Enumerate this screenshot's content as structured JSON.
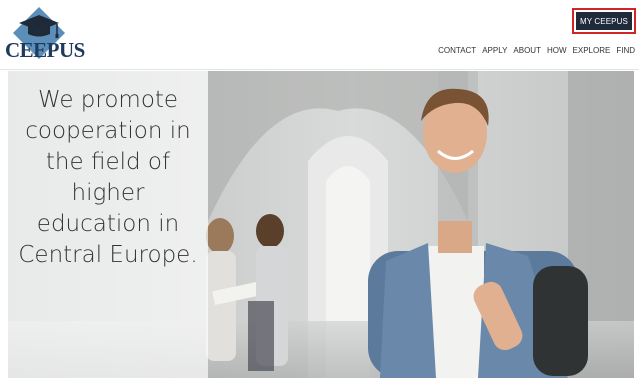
{
  "header": {
    "logo_text": "CEEPUS",
    "my_ceepus_label": "MY CEEPUS",
    "nav": [
      "CONTACT",
      "APPLY",
      "ABOUT",
      "HOW",
      "EXPLORE",
      "FIND"
    ]
  },
  "hero": {
    "tagline": "We promote cooperation in the field of higher education in Central Europe."
  },
  "colors": {
    "brand_navy": "#1e3a5c",
    "logo_diamond": "#5b8fb9",
    "button_dark": "#1f2a3a",
    "button_outline": "#d0262a"
  }
}
